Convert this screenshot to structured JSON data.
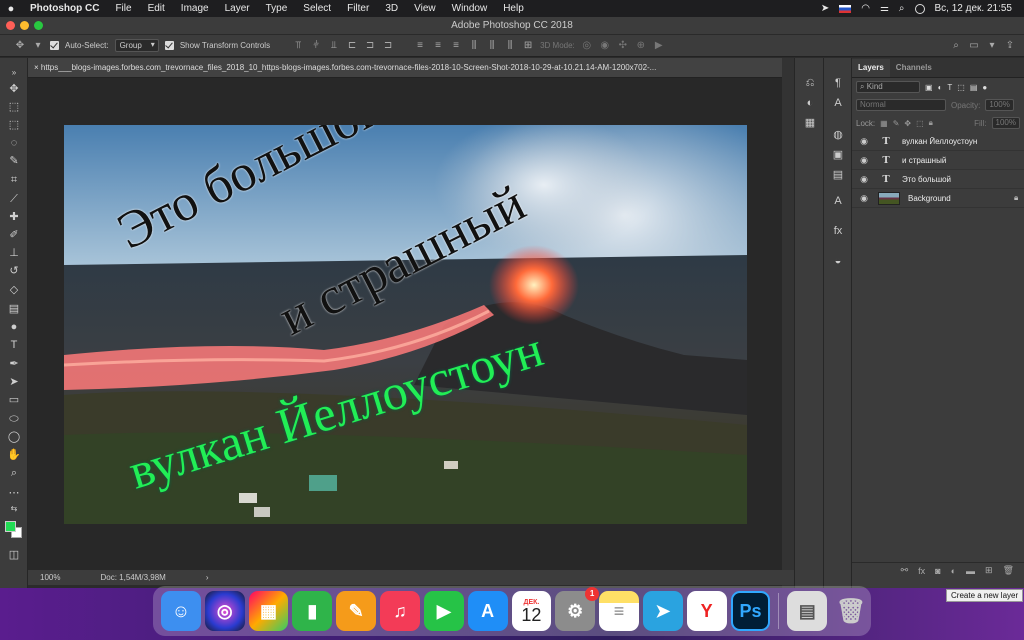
{
  "menubar": {
    "app": "Photoshop CC",
    "items": [
      "File",
      "Edit",
      "Image",
      "Layer",
      "Type",
      "Select",
      "Filter",
      "3D",
      "View",
      "Window",
      "Help"
    ],
    "datetime": "Вс, 12 дек.  21:55"
  },
  "window": {
    "title": "Adobe Photoshop CC 2018"
  },
  "options": {
    "auto_select_label": "Auto-Select:",
    "auto_select_value": "Group",
    "transform_label": "Show Transform Controls",
    "mode_3d_label": "3D Mode:"
  },
  "tab": {
    "title": "https___blogs-images.forbes.com_trevornace_files_2018_10_https-blogs-images.forbes.com-trevornace-files-2018-10-Screen-Shot-2018-10-29-at-10.21.14-AM-1200x702-..."
  },
  "canvas": {
    "text_line1": "Это большой",
    "text_line2": "и страшный",
    "text_line3": "вулкан Йеллоустоун",
    "text_color_dark": "#111111",
    "text_color_green": "#22ee55"
  },
  "status": {
    "zoom": "100%",
    "doc": "Doc: 1,54M/3,98M"
  },
  "layers_panel": {
    "tabs": [
      "Layers",
      "Channels"
    ],
    "filter_kind": "Kind",
    "blend_mode": "Normal",
    "opacity_label": "Opacity:",
    "opacity_value": "100%",
    "lock_label": "Lock:",
    "fill_label": "Fill:",
    "fill_value": "100%",
    "layers": [
      {
        "name": "вулкан Йеллоустоун",
        "kind": "T"
      },
      {
        "name": "и страшный",
        "kind": "T"
      },
      {
        "name": "Это большой",
        "kind": "T"
      },
      {
        "name": "Background",
        "kind": "image"
      }
    ],
    "tooltip": "Create a new layer"
  },
  "dock": {
    "calendar_month": "ДЕК.",
    "calendar_day": "12",
    "settings_badge": "1",
    "photoshop_label": "Ps"
  }
}
